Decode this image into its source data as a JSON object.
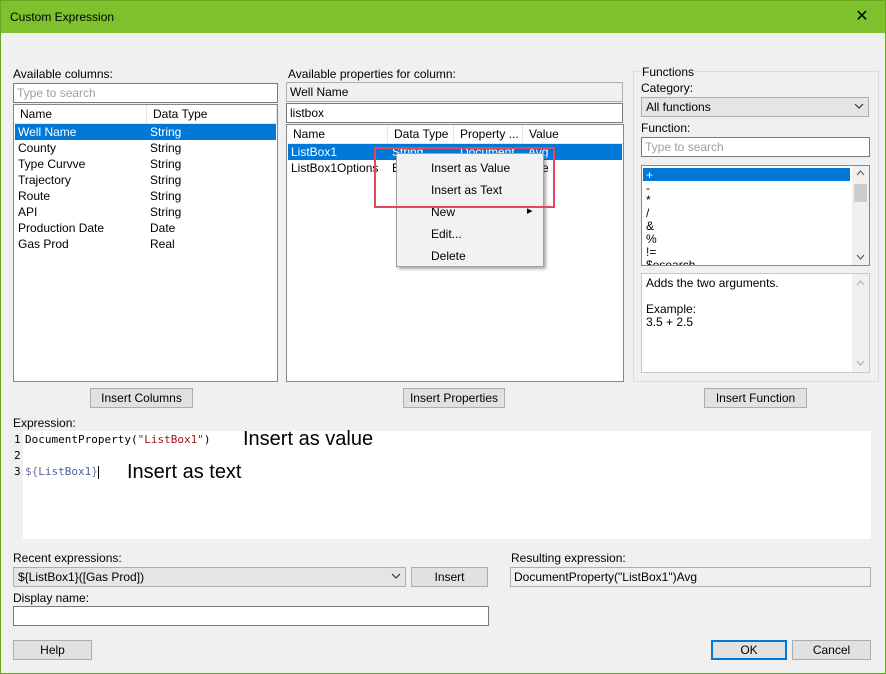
{
  "window": {
    "title": "Custom Expression",
    "close_glyph": "✕"
  },
  "columns": {
    "label": "Available columns:",
    "search_placeholder": "Type to search",
    "headers": {
      "name": "Name",
      "type": "Data Type"
    },
    "rows": [
      {
        "name": "Well Name",
        "type": "String"
      },
      {
        "name": "County",
        "type": "String"
      },
      {
        "name": "Type Curvve",
        "type": "String"
      },
      {
        "name": "Trajectory",
        "type": "String"
      },
      {
        "name": "Route",
        "type": "String"
      },
      {
        "name": "API",
        "type": "String"
      },
      {
        "name": "Production Date",
        "type": "Date"
      },
      {
        "name": "Gas Prod",
        "type": "Real"
      }
    ],
    "insert_button": "Insert Columns"
  },
  "properties": {
    "label": "Available properties for column:",
    "column_value": "Well Name",
    "search_value": "listbox",
    "headers": {
      "name": "Name",
      "type": "Data Type",
      "property": "Property ...",
      "value": "Value"
    },
    "rows": [
      {
        "name": "ListBox1",
        "type": "String",
        "property": "Document",
        "value": "Avg"
      },
      {
        "name": "ListBox1Options",
        "type": "B",
        "property": "",
        "value": "e"
      }
    ],
    "insert_button": "Insert Properties"
  },
  "context_menu": {
    "items": [
      "Insert as Value",
      "Insert as Text",
      "New",
      "Edit...",
      "Delete"
    ],
    "submenu_glyph": "▸"
  },
  "functions": {
    "group_label": "Functions",
    "category_label": "Category:",
    "category_value": "All functions",
    "function_label": "Function:",
    "search_placeholder": "Type to search",
    "list": [
      "+",
      "-",
      "*",
      "/",
      "&",
      "%",
      "!=",
      "$esearch"
    ],
    "description": [
      "Adds the two arguments.",
      "",
      "Example:",
      "3.5 + 2.5"
    ],
    "insert_button": "Insert Function"
  },
  "expression": {
    "label": "Expression:",
    "line_numbers": [
      "1",
      "2",
      "3"
    ],
    "line1_func": "DocumentProperty(",
    "line1_str": "\"ListBox1\"",
    "line1_close": ")",
    "line3_prefix": "${",
    "line3_name": "ListBox1",
    "line3_suffix": "}",
    "annotation_value": "Insert as value",
    "annotation_text": "Insert as text"
  },
  "recent": {
    "label": "Recent expressions:",
    "value": "${ListBox1}([Gas Prod])",
    "insert_button": "Insert"
  },
  "resulting": {
    "label": "Resulting expression:",
    "value": "DocumentProperty(\"ListBox1\")Avg"
  },
  "display_name": {
    "label": "Display name:",
    "value": ""
  },
  "buttons": {
    "help": "Help",
    "ok": "OK",
    "cancel": "Cancel"
  },
  "colors": {
    "title_bar": "#7dc12d",
    "selection": "#0078d7",
    "callout": "#e04a5a",
    "string_literal": "#a31515"
  }
}
